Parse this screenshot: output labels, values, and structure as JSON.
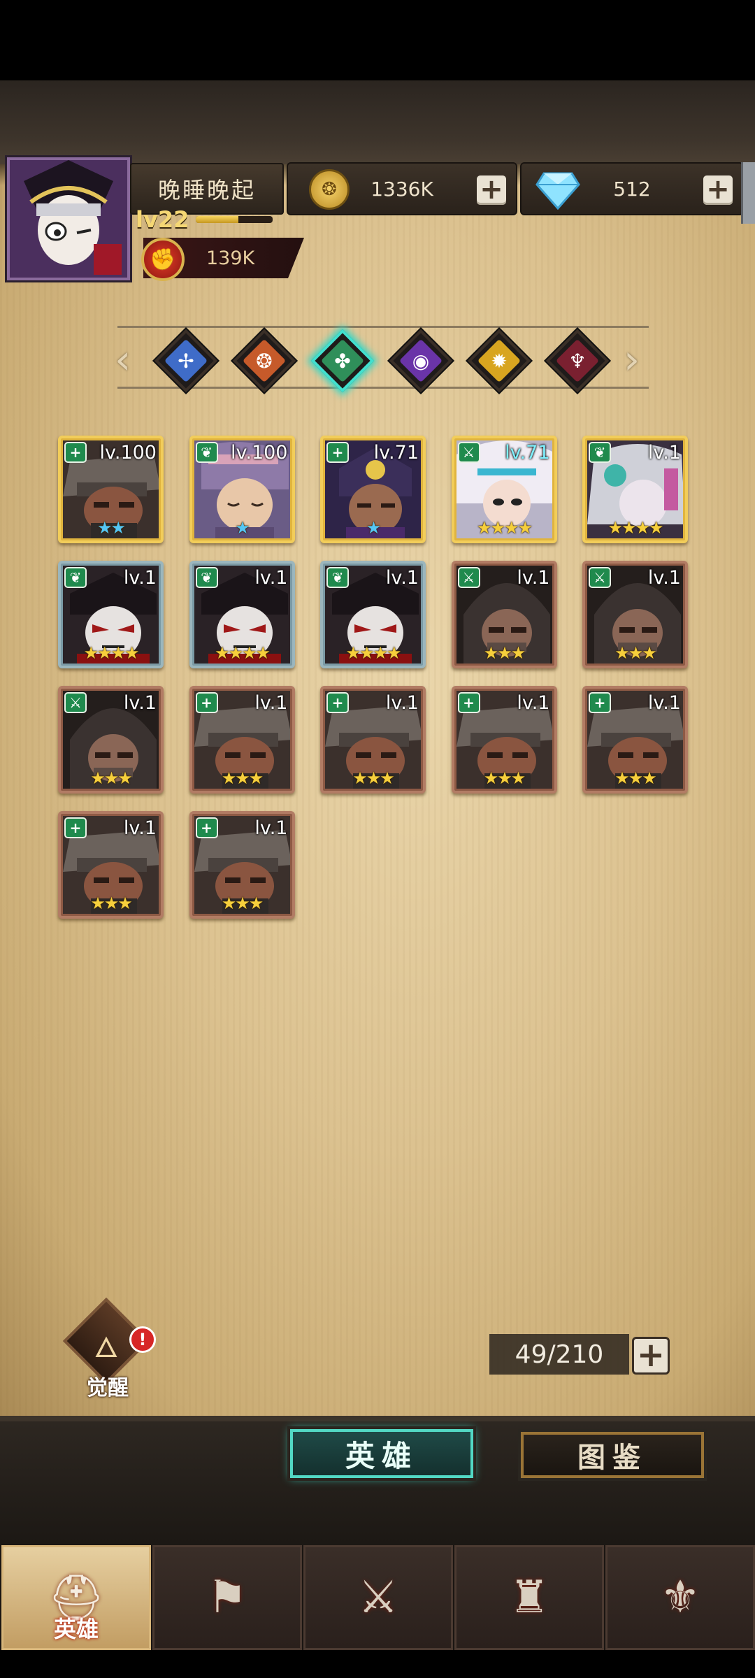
{
  "player": {
    "name": "晚睡晚起",
    "level": "lv22",
    "level_progress": 0.55,
    "power": "139K"
  },
  "currencies": {
    "gold": "1336K",
    "gems": "512"
  },
  "element_filters": [
    {
      "name": "light",
      "color": "#3f6cc8",
      "glyph": "✢"
    },
    {
      "name": "fire",
      "color": "#c65a2a",
      "glyph": "❂"
    },
    {
      "name": "nature",
      "color": "#2f8f5a",
      "glyph": "✤",
      "active": true
    },
    {
      "name": "shadow",
      "color": "#6a34a8",
      "glyph": "◉"
    },
    {
      "name": "holy",
      "color": "#d8a520",
      "glyph": "✹"
    },
    {
      "name": "blood",
      "color": "#7a2030",
      "glyph": "♆"
    }
  ],
  "heroes": [
    {
      "level": "lv.100",
      "stars": "★★",
      "star_color": "blue",
      "frame": "gold",
      "class": "plus",
      "art": "bandit"
    },
    {
      "level": "lv.100",
      "stars": "★",
      "star_color": "blue",
      "frame": "gold",
      "class": "leaf",
      "art": "sleeper"
    },
    {
      "level": "lv.71",
      "stars": "★",
      "star_color": "blue",
      "frame": "gold",
      "class": "plus",
      "art": "mystic"
    },
    {
      "level": "lv.71",
      "stars": "★★★★",
      "star_color": "gold",
      "frame": "gold",
      "class": "sword",
      "art": "priestess",
      "level_color": "cyan"
    },
    {
      "level": "lv.1",
      "stars": "★★★★",
      "star_color": "gold",
      "frame": "gold",
      "class": "leaf",
      "art": "witch"
    },
    {
      "level": "lv.1",
      "stars": "★★★★",
      "star_color": "gold",
      "frame": "blue",
      "class": "leaf",
      "art": "vampire"
    },
    {
      "level": "lv.1",
      "stars": "★★★★",
      "star_color": "gold",
      "frame": "blue",
      "class": "leaf",
      "art": "vampire"
    },
    {
      "level": "lv.1",
      "stars": "★★★★",
      "star_color": "gold",
      "frame": "blue",
      "class": "leaf",
      "art": "vampire"
    },
    {
      "level": "lv.1",
      "stars": "★★★",
      "star_color": "gold",
      "frame": "brown",
      "class": "sword",
      "art": "hood"
    },
    {
      "level": "lv.1",
      "stars": "★★★",
      "star_color": "gold",
      "frame": "brown",
      "class": "sword",
      "art": "hood"
    },
    {
      "level": "lv.1",
      "stars": "★★★",
      "star_color": "gold",
      "frame": "brown",
      "class": "sword",
      "art": "hood"
    },
    {
      "level": "lv.1",
      "stars": "★★★",
      "star_color": "gold",
      "frame": "brown",
      "class": "plus",
      "art": "bandit"
    },
    {
      "level": "lv.1",
      "stars": "★★★",
      "star_color": "gold",
      "frame": "brown",
      "class": "plus",
      "art": "bandit"
    },
    {
      "level": "lv.1",
      "stars": "★★★",
      "star_color": "gold",
      "frame": "brown",
      "class": "plus",
      "art": "bandit"
    },
    {
      "level": "lv.1",
      "stars": "★★★",
      "star_color": "gold",
      "frame": "brown",
      "class": "plus",
      "art": "bandit"
    },
    {
      "level": "lv.1",
      "stars": "★★★",
      "star_color": "gold",
      "frame": "brown",
      "class": "plus",
      "art": "bandit"
    },
    {
      "level": "lv.1",
      "stars": "★★★",
      "star_color": "gold",
      "frame": "brown",
      "class": "plus",
      "art": "bandit"
    }
  ],
  "awaken": {
    "label": "觉醒",
    "alert": "!"
  },
  "capacity": "49/210",
  "tabs": {
    "heroes": "英雄",
    "codex": "图鉴"
  },
  "nav": [
    {
      "name": "heroes",
      "label": "英雄",
      "glyph": "⛑",
      "active": true
    },
    {
      "name": "adventure",
      "label": "",
      "glyph": "⚑"
    },
    {
      "name": "battle",
      "label": "",
      "glyph": "⚔"
    },
    {
      "name": "castle",
      "label": "",
      "glyph": "♜"
    },
    {
      "name": "guild",
      "label": "",
      "glyph": "⚜"
    }
  ]
}
